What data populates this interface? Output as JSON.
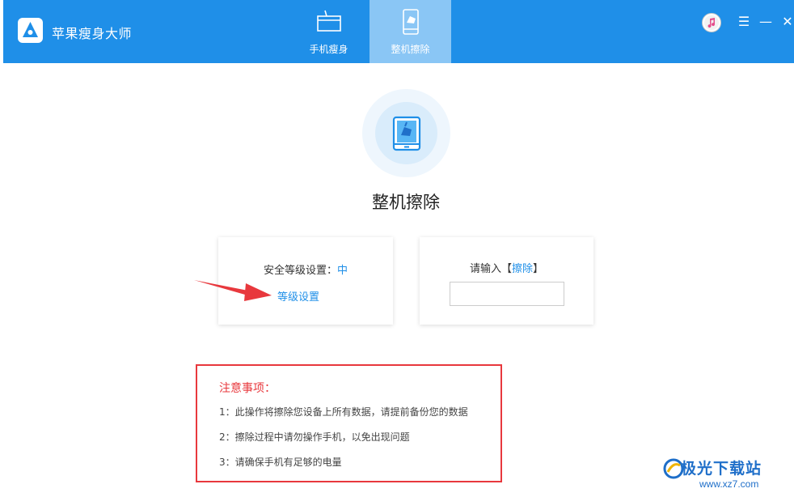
{
  "app": {
    "title": "苹果瘦身大师",
    "logo_icon": "app-logo-icon"
  },
  "tabs": [
    {
      "label": "手机瘦身",
      "icon": "broom-icon",
      "active": false
    },
    {
      "label": "整机擦除",
      "icon": "phone-erase-icon",
      "active": true
    }
  ],
  "window_controls": {
    "itunes_icon": "itunes-icon",
    "menu": "☰",
    "minimize": "—",
    "close": "✕"
  },
  "main": {
    "title": "整机擦除",
    "hero_icon": "phone-erase-icon"
  },
  "security_card": {
    "label": "安全等级设置：",
    "level": "中",
    "link": "等级设置"
  },
  "erase_card": {
    "prompt_prefix": "请输入【",
    "keyword": "擦除",
    "prompt_suffix": "】",
    "input_value": ""
  },
  "notice": {
    "title": "注意事项：",
    "items": [
      "1：此操作将擦除您设备上所有数据，请提前备份您的数据",
      "2：擦除过程中请勿操作手机，以免出现问题",
      "3：请确保手机有足够的电量"
    ]
  },
  "watermark": {
    "text": "极光下载站",
    "url": "www.xz7.com"
  },
  "colors": {
    "accent": "#1f8fe8",
    "warning": "#e8383d",
    "arrow": "#e8383d"
  }
}
